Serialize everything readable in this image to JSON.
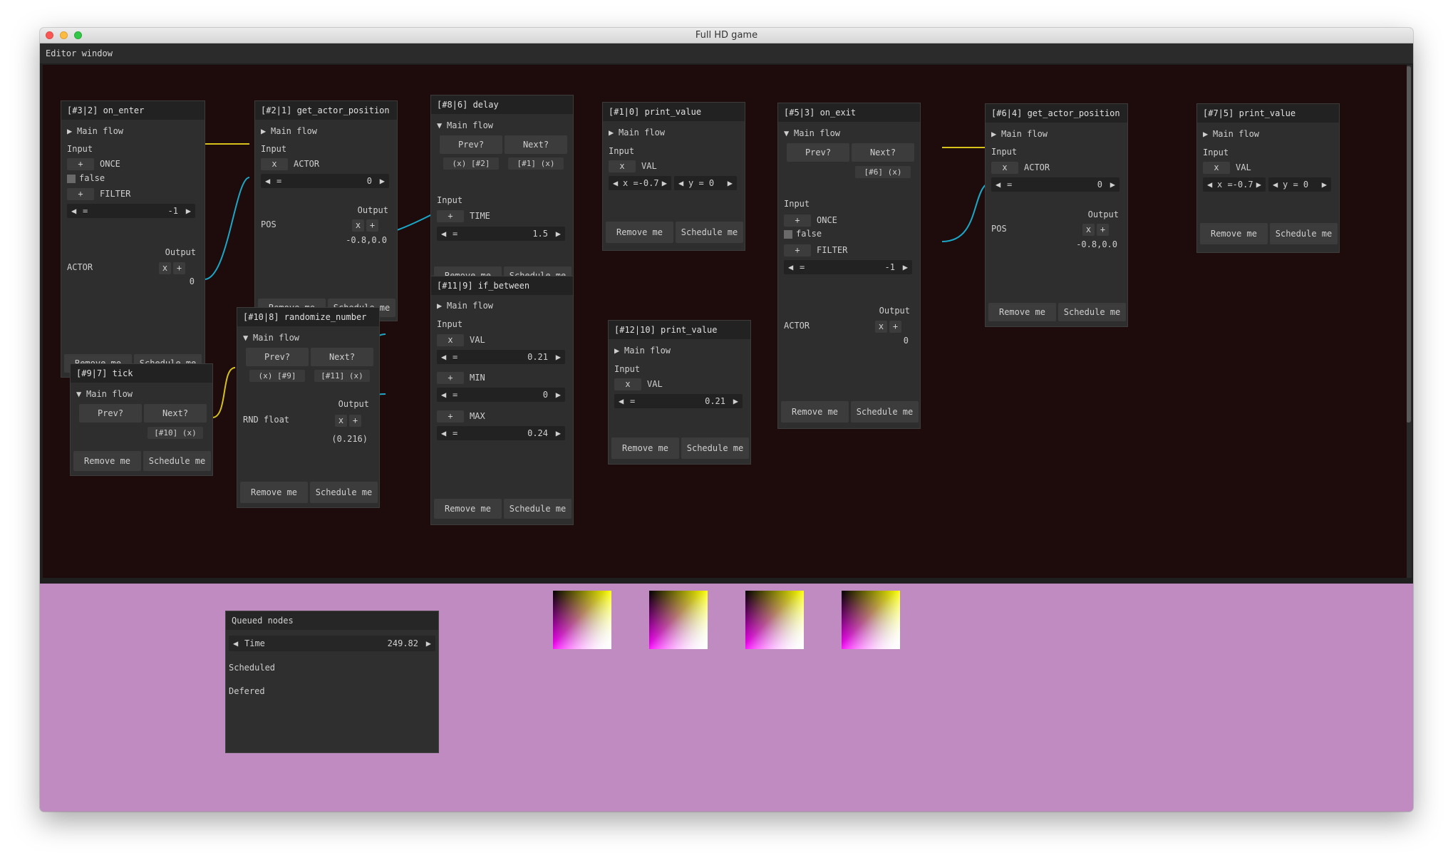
{
  "window": {
    "title": "Full HD game"
  },
  "editor": {
    "title": "Editor window"
  },
  "common": {
    "main_flow": "Main flow",
    "input": "Input",
    "output": "Output",
    "remove": "Remove me",
    "schedule": "Schedule me",
    "prev": "Prev?",
    "next": "Next?",
    "x": "x",
    "plus": "+",
    "left_arrow": "◀",
    "right_arrow": "▶",
    "eq": "=",
    "collapsed_arrow": "▶",
    "expanded_arrow": "▼"
  },
  "nodes": {
    "n32": {
      "title": "[#3|2] on_enter",
      "once": "ONCE",
      "false": "false",
      "filter": "FILTER",
      "value": "-1",
      "actor": "ACTOR",
      "zero": "0"
    },
    "n21": {
      "title": "[#2|1] get_actor_position",
      "actor": "ACTOR",
      "value": "0",
      "pos": "POS",
      "pos_value": "-0.8,0.0"
    },
    "n86": {
      "title": "[#8|6] delay",
      "prev_link": "(x) [#2]",
      "next_link": "[#1] (x)",
      "time": "TIME",
      "time_value": "1.5"
    },
    "n10": {
      "title": "[#1|0] print_value",
      "val": "VAL",
      "x_field": "x =-0.7",
      "y_field": "y =  0"
    },
    "n53": {
      "title": "[#5|3] on_exit",
      "next_link": "[#6] (x)",
      "once": "ONCE",
      "false": "false",
      "filter": "FILTER",
      "value": "-1",
      "actor": "ACTOR",
      "zero": "0"
    },
    "n64": {
      "title": "[#6|4] get_actor_position",
      "actor": "ACTOR",
      "value": "0",
      "pos": "POS",
      "pos_value": "-0.8,0.0"
    },
    "n75": {
      "title": "[#7|5] print_value",
      "val": "VAL",
      "x_field": "x =-0.7",
      "y_field": "y =  0"
    },
    "n119": {
      "title": "[#11|9] if_between",
      "val": "VAL",
      "val_value": "0.21",
      "min": "MIN",
      "min_value": "0",
      "max": "MAX",
      "max_value": "0.24"
    },
    "n108": {
      "title": "[#10|8] randomize_number",
      "prev_link": "(x) [#9]",
      "next_link": "[#11] (x)",
      "rnd": "RND float",
      "rnd_value": "(0.216)"
    },
    "n97": {
      "title": "[#9|7] tick",
      "next_link": "[#10] (x)"
    },
    "n1210": {
      "title": "[#12|10] print_value",
      "val": "VAL",
      "val_value": "0.21"
    }
  },
  "queue": {
    "title": "Queued nodes",
    "time_label": "Time",
    "time_value": "249.82",
    "scheduled": "Scheduled",
    "defered": "Defered"
  },
  "colors": {
    "flow_wire": "#d6c21a",
    "data_wire": "#1aa8c8",
    "canvas": "#1e0b0b",
    "bottom": "#c08bc0"
  }
}
